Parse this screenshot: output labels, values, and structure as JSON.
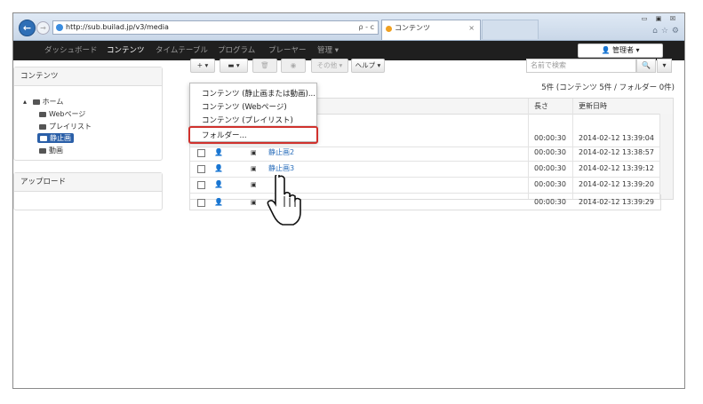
{
  "browser": {
    "url": "http://sub.builad.jp/v3/media",
    "search_glyph": "ρ - c",
    "tab_title": "コンテンツ",
    "tab_close": "×",
    "window_controls": [
      "▭",
      "▣",
      "☒"
    ],
    "tool_icons": [
      "⌂",
      "☆",
      "⚙"
    ]
  },
  "navbar": {
    "items": [
      {
        "label": "ダッシュボード",
        "active": false
      },
      {
        "label": "コンテンツ",
        "active": true
      },
      {
        "label": "タイムテーブル",
        "active": false
      },
      {
        "label": "プログラム",
        "active": false
      },
      {
        "label": "プレーヤー",
        "active": false
      },
      {
        "label": "管理 ▾",
        "active": false
      }
    ],
    "user_button": "👤 管理者 ▾"
  },
  "sidebar": {
    "content_panel_title": "コンテンツ",
    "tree": [
      {
        "label": "ホーム",
        "prefix": "▴"
      },
      {
        "label": "Webページ"
      },
      {
        "label": "プレイリスト"
      },
      {
        "label": "静止画",
        "selected": true
      },
      {
        "label": "動画"
      }
    ],
    "upload_panel_title": "アップロード"
  },
  "toolbar": {
    "add": "+ ▾",
    "folder": "▬ ▾",
    "delete": "🗑",
    "view": "◉",
    "other": "その他 ▾",
    "help": "ヘルプ ▾",
    "search_placeholder": "名前で検索",
    "search_btn": "🔍",
    "search_dropdown": "▾"
  },
  "count_text": "5件 (コンテンツ 5件 / フォルダー 0件)",
  "table": {
    "headers": {
      "length": "長さ",
      "updated": "更新日時"
    },
    "rows": [
      {
        "name": "",
        "length": "00:00:30",
        "updated": "2014-02-12 13:39:04"
      },
      {
        "name": "静止画2",
        "length": "00:00:30",
        "updated": "2014-02-12 13:38:57"
      },
      {
        "name": "静止画3",
        "length": "00:00:30",
        "updated": "2014-02-12 13:39:12"
      },
      {
        "name": "",
        "length": "00:00:30",
        "updated": "2014-02-12 13:39:20"
      },
      {
        "name": "",
        "length": "00:00:30",
        "updated": "2014-02-12 13:39:29"
      }
    ],
    "user_glyph": "👤",
    "image_glyph": "▣"
  },
  "menu": {
    "items": [
      "コンテンツ (静止画または動画)...",
      "コンテンツ (Webページ)",
      "コンテンツ (プレイリスト)",
      "フォルダー..."
    ]
  },
  "colors": {
    "highlight": "#d0312d",
    "nav_bg": "#1f1f1f",
    "link": "#2a6ebb",
    "selected": "#2a5fa8"
  },
  "icons": [
    "back-arrow-icon",
    "forward-arrow-icon",
    "ie-icon",
    "home-icon",
    "star-icon",
    "gear-icon",
    "folder-icon",
    "user-icon",
    "image-icon",
    "search-icon",
    "hand-cursor-icon"
  ]
}
